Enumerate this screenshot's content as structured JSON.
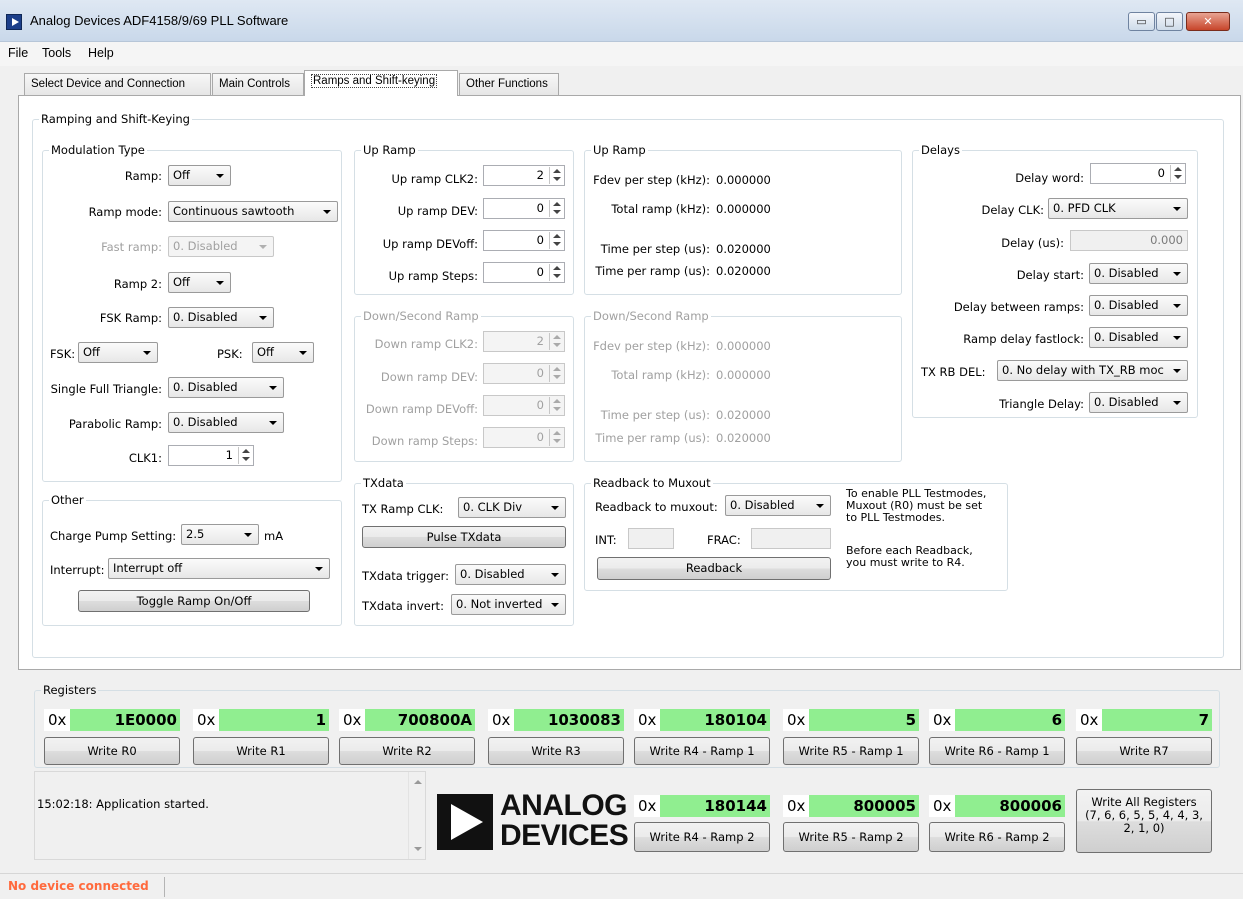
{
  "window": {
    "title": "Analog Devices ADF4158/9/69 PLL Software",
    "minimize_glyph": "▭",
    "maximize_glyph": "□",
    "close_glyph": "✕"
  },
  "menu": [
    "File",
    "Tools",
    "Help"
  ],
  "tabs": [
    "Select Device and Connection",
    "Main Controls",
    "Ramps and Shift-keying",
    "Other Functions"
  ],
  "panel": {
    "title": "Ramping and Shift-Keying"
  },
  "modulation": {
    "title": "Modulation Type",
    "ramp_label": "Ramp:",
    "ramp_value": "Off",
    "ramp_mode_label": "Ramp mode:",
    "ramp_mode_value": "Continuous sawtooth",
    "fast_ramp_label": "Fast ramp:",
    "fast_ramp_value": "0. Disabled",
    "ramp2_label": "Ramp 2:",
    "ramp2_value": "Off",
    "fsk_ramp_label": "FSK Ramp:",
    "fsk_ramp_value": "0. Disabled",
    "fsk_label": "FSK:",
    "fsk_value": "Off",
    "psk_label": "PSK:",
    "psk_value": "Off",
    "single_full_triangle_label": "Single Full Triangle:",
    "single_full_triangle_value": "0. Disabled",
    "parabolic_ramp_label": "Parabolic Ramp:",
    "parabolic_ramp_value": "0. Disabled",
    "clk1_label": "CLK1:",
    "clk1_value": "1"
  },
  "up_ramp": {
    "title": "Up Ramp",
    "clk2_label": "Up ramp CLK2:",
    "clk2_value": "2",
    "dev_label": "Up ramp DEV:",
    "dev_value": "0",
    "devoff_label": "Up ramp DEVoff:",
    "devoff_value": "0",
    "steps_label": "Up ramp Steps:",
    "steps_value": "0"
  },
  "up_ramp_info": {
    "title": "Up Ramp",
    "fdev_label": "Fdev per step (kHz):",
    "fdev_value": "0.000000",
    "total_label": "Total ramp (kHz):",
    "total_value": "0.000000",
    "time_step_label": "Time per step (us):",
    "time_step_value": "0.020000",
    "time_ramp_label": "Time per ramp (us):",
    "time_ramp_value": "0.020000"
  },
  "down_ramp": {
    "title": "Down/Second Ramp",
    "clk2_label": "Down ramp CLK2:",
    "clk2_value": "2",
    "dev_label": "Down ramp DEV:",
    "dev_value": "0",
    "devoff_label": "Down ramp DEVoff:",
    "devoff_value": "0",
    "steps_label": "Down ramp Steps:",
    "steps_value": "0"
  },
  "down_ramp_info": {
    "title": "Down/Second Ramp",
    "fdev_label": "Fdev per step (kHz):",
    "fdev_value": "0.000000",
    "total_label": "Total ramp (kHz):",
    "total_value": "0.000000",
    "time_step_label": "Time per step (us):",
    "time_step_value": "0.020000",
    "time_ramp_label": "Time per ramp (us):",
    "time_ramp_value": "0.020000"
  },
  "delays": {
    "title": "Delays",
    "delay_word_label": "Delay word:",
    "delay_word_value": "0",
    "delay_clk_label": "Delay CLK:",
    "delay_clk_value": "0. PFD CLK",
    "delay_us_label": "Delay (us):",
    "delay_us_value": "0.000",
    "delay_start_label": "Delay start:",
    "delay_start_value": "0. Disabled",
    "between_label": "Delay between ramps:",
    "between_value": "0. Disabled",
    "fastlock_label": "Ramp delay fastlock:",
    "fastlock_value": "0. Disabled",
    "txrb_label": "TX RB DEL:",
    "txrb_value": "0. No delay with TX_RB moc",
    "triangle_label": "Triangle Delay:",
    "triangle_value": "0. Disabled"
  },
  "other": {
    "title": "Other",
    "cp_label": "Charge Pump Setting:",
    "cp_value": "2.5",
    "cp_unit": "mA",
    "interrupt_label": "Interrupt:",
    "interrupt_value": "Interrupt off",
    "toggle_button": "Toggle Ramp On/Off"
  },
  "txdata": {
    "title": "TXdata",
    "clk_label": "TX Ramp CLK:",
    "clk_value": "0. CLK Div",
    "pulse_button": "Pulse TXdata",
    "trigger_label": "TXdata trigger:",
    "trigger_value": "0. Disabled",
    "invert_label": "TXdata invert:",
    "invert_value": "0. Not inverted"
  },
  "readback": {
    "title": "Readback to Muxout",
    "label": "Readback to muxout:",
    "value": "0. Disabled",
    "int_label": "INT:",
    "frac_label": "FRAC:",
    "button": "Readback",
    "note1_line1": "To enable PLL Testmodes,",
    "note1_line2": "Muxout (R0) must be set",
    "note1_line3": "to PLL Testmodes.",
    "note2_line1": "Before each Readback,",
    "note2_line2": "you must write to R4."
  },
  "registers": {
    "title": "Registers",
    "prefix": "0x",
    "row1": [
      {
        "value": "1E0000",
        "button": "Write R0"
      },
      {
        "value": "1",
        "button": "Write R1"
      },
      {
        "value": "700800A",
        "button": "Write R2"
      },
      {
        "value": "1030083",
        "button": "Write R3"
      },
      {
        "value": "180104",
        "button": "Write R4 - Ramp 1"
      },
      {
        "value": "5",
        "button": "Write R5 - Ramp 1"
      },
      {
        "value": "6",
        "button": "Write R6 - Ramp 1"
      },
      {
        "value": "7",
        "button": "Write R7"
      }
    ],
    "row2": [
      {
        "value": "180144",
        "button": "Write R4 - Ramp 2"
      },
      {
        "value": "800005",
        "button": "Write R5 - Ramp 2"
      },
      {
        "value": "800006",
        "button": "Write R6 - Ramp 2"
      }
    ],
    "write_all_line1": "Write All Registers",
    "write_all_line2": "(7, 6, 6, 5, 5, 4, 4, 3,",
    "write_all_line3": "2, 1, 0)"
  },
  "log": {
    "text": "15:02:18: Application started."
  },
  "logo": {
    "line1": "ANALOG",
    "line2": "DEVICES"
  },
  "status": {
    "text": "No device connected"
  },
  "colors": {
    "register_value_bg": "#90ee90",
    "status_text": "#ff6a3d",
    "logo": "#111111"
  }
}
